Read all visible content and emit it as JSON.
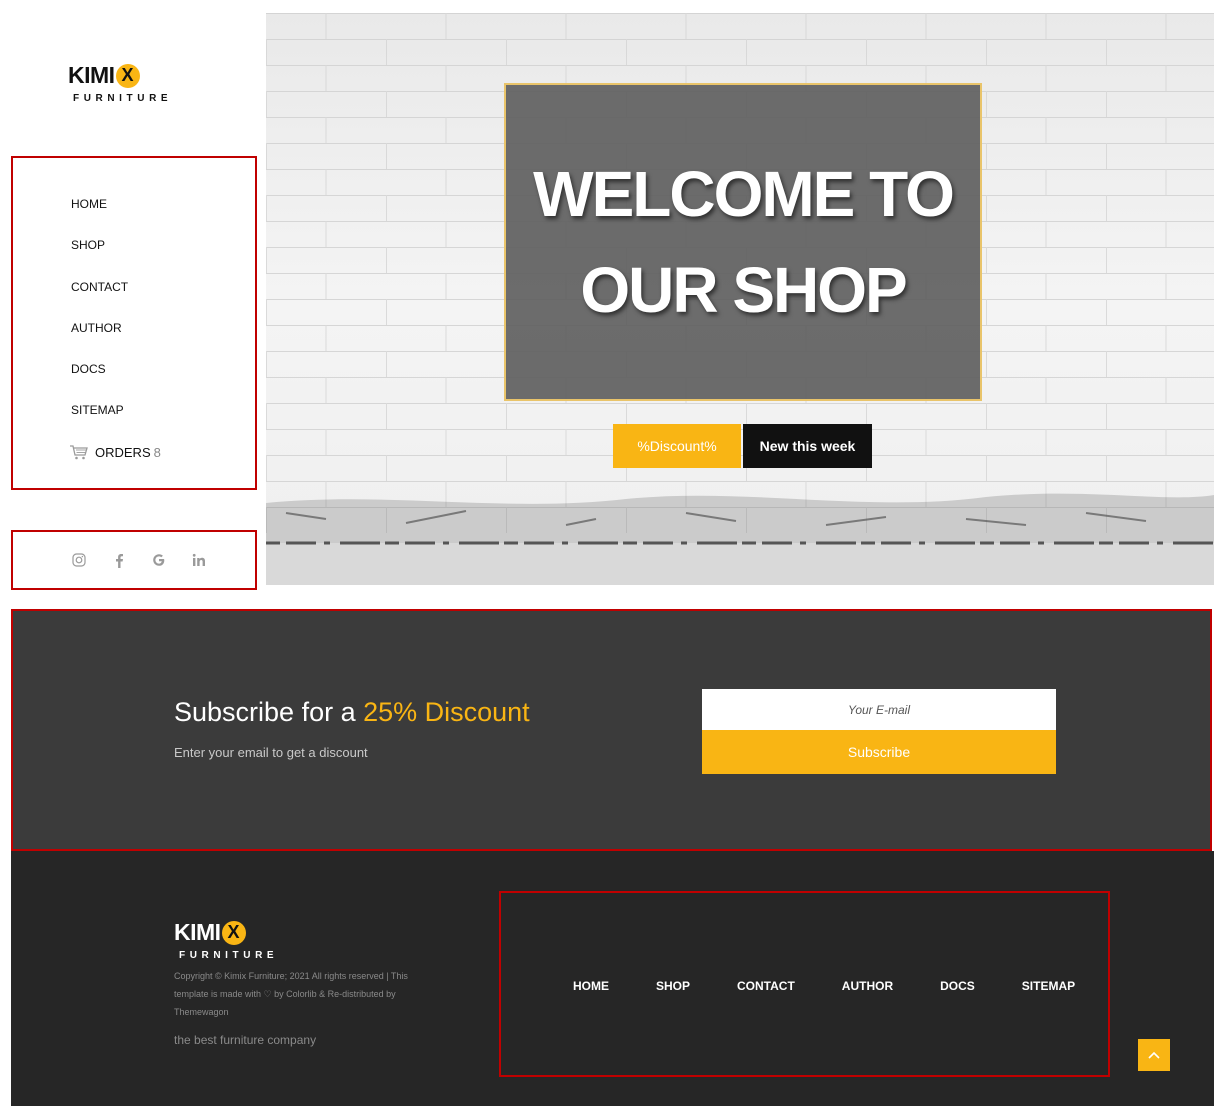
{
  "brand": {
    "name": "KIMI",
    "x_mark": "X",
    "tagline": "FURNITURE"
  },
  "sidebar": {
    "nav": [
      {
        "label": "HOME"
      },
      {
        "label": "SHOP"
      },
      {
        "label": "CONTACT"
      },
      {
        "label": "AUTHOR"
      },
      {
        "label": "DOCS"
      },
      {
        "label": "SITEMAP"
      }
    ],
    "orders": {
      "label": "ORDERS",
      "count": "8",
      "icon": "cart-icon"
    },
    "social": [
      "instagram-icon",
      "facebook-icon",
      "google-icon",
      "linkedin-icon"
    ]
  },
  "hero": {
    "title_line1": "WELCOME TO",
    "title_line2": "OUR SHOP",
    "btn_discount": "%Discount%",
    "btn_new": "New this week"
  },
  "subscribe": {
    "title_prefix": "Subscribe for a ",
    "title_accent": "25% Discount",
    "description": "Enter your email to get a discount",
    "email_placeholder": "Your E-mail",
    "button_label": "Subscribe"
  },
  "footer": {
    "copyright": "Copyright © Kimix Furniture; 2021 All rights reserved | This template is made with ♡ by Colorlib & Re-distributed by Themewagon",
    "tagline": "the best furniture company",
    "nav": [
      {
        "label": "HOME"
      },
      {
        "label": "SHOP"
      },
      {
        "label": "CONTACT"
      },
      {
        "label": "AUTHOR"
      },
      {
        "label": "DOCS"
      },
      {
        "label": "SITEMAP"
      }
    ],
    "to_top_icon": "chevron-up-icon"
  },
  "colors": {
    "accent": "#f9b514",
    "dark": "#262626",
    "subscribe_bg": "#3b3b3b",
    "highlight_border": "#c00000"
  }
}
